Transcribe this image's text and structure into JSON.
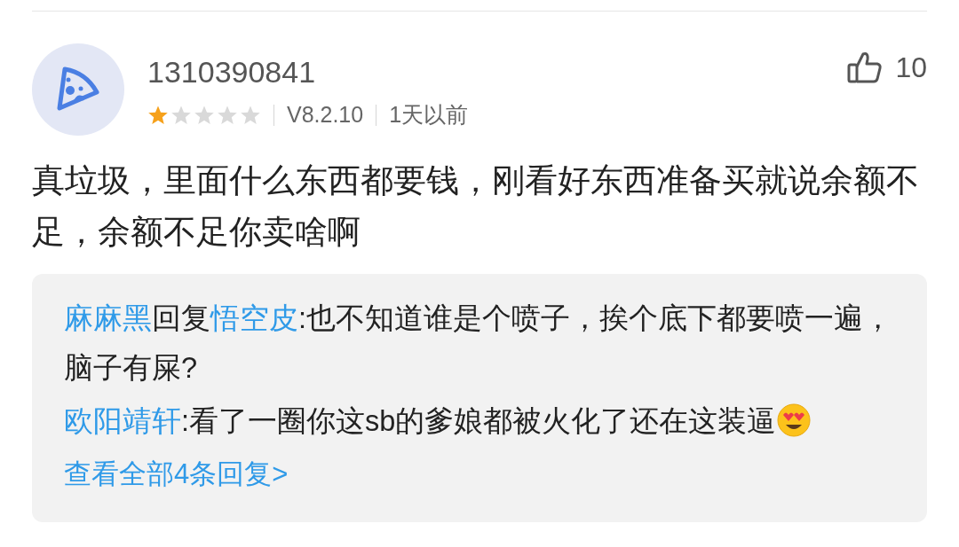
{
  "comment": {
    "username": "1310390841",
    "stars": 1,
    "version": "V8.2.10",
    "time": "1天以前",
    "likes": "10",
    "body": "真垃圾，里面什么东西都要钱，刚看好东西准备买就说余额不足，余额不足你卖啥啊"
  },
  "replies": [
    {
      "author": "麻麻黑",
      "connector": "回复",
      "reply_to": "悟空皮",
      "text": ":也不知道谁是个喷子，挨个底下都要喷一遍，脑子有屎?",
      "has_emoji": false
    },
    {
      "author": "欧阳靖轩",
      "text": ":看了一圈你这sb的爹娘都被火化了还在这装逼",
      "has_emoji": true
    }
  ],
  "more_replies": "查看全部4条回复>"
}
